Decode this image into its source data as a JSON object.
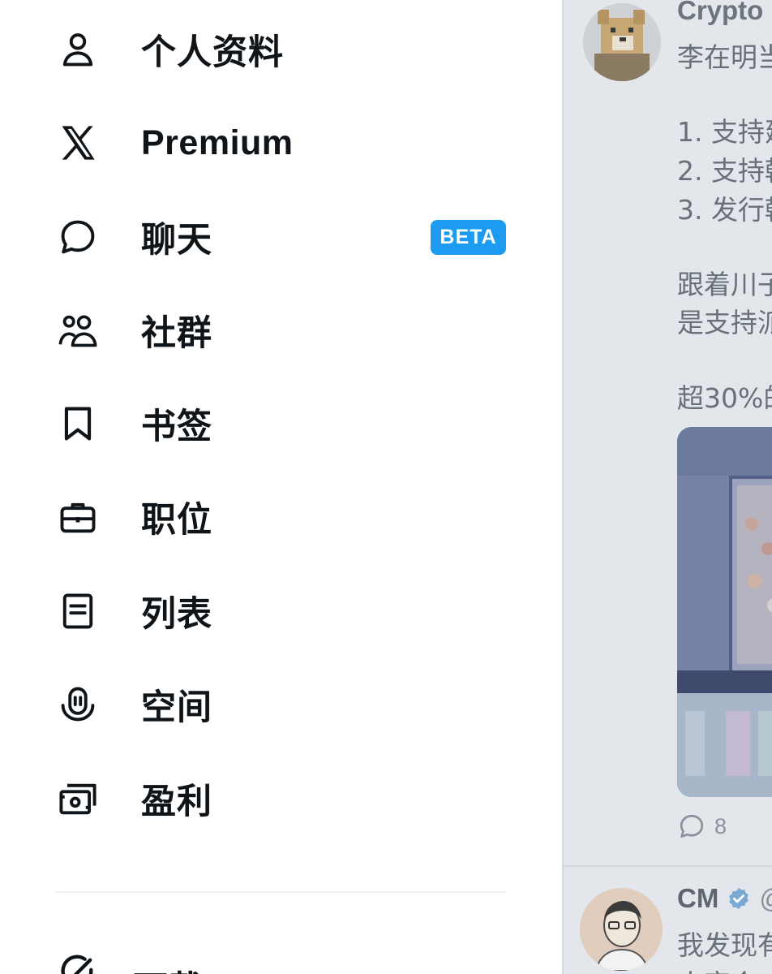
{
  "drawer": {
    "items": [
      {
        "label": "个人资料",
        "icon": "profile-icon"
      },
      {
        "label": "Premium",
        "icon": "x-logo-icon"
      },
      {
        "label": "聊天",
        "icon": "chat-bubble-icon",
        "badge": "BETA"
      },
      {
        "label": "社群",
        "icon": "communities-icon"
      },
      {
        "label": "书签",
        "icon": "bookmark-icon"
      },
      {
        "label": "职位",
        "icon": "briefcase-icon"
      },
      {
        "label": "列表",
        "icon": "list-icon"
      },
      {
        "label": "空间",
        "icon": "spaces-icon"
      },
      {
        "label": "盈利",
        "icon": "monetization-icon"
      }
    ],
    "download_label": "下载 Grok"
  },
  "timeline": {
    "tweet1": {
      "author": "Crypto",
      "lines": [
        "李在明当",
        "1. 支持建",
        "2. 支持韩",
        "3. 发行韩",
        "跟着川子",
        "是支持派",
        "超30%的"
      ],
      "reply_count": "8"
    },
    "tweet2": {
      "author": "CM",
      "handle": "@",
      "lines": [
        "我发现有",
        "人宗会"
      ]
    }
  },
  "colors": {
    "accent": "#1d9bf0",
    "text": "#0f1419",
    "overlay": "#e3e6eb"
  }
}
